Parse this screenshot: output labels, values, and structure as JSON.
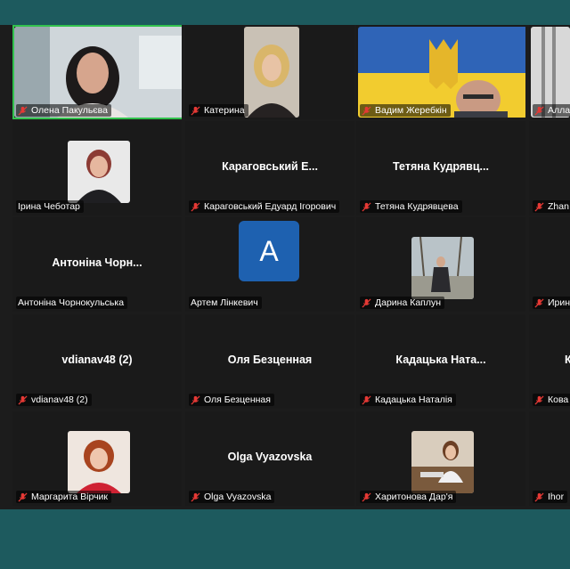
{
  "participants": [
    {
      "name": "Олена Пакульєва",
      "center": "",
      "kind": "video-woman"
    },
    {
      "name": "Катерина",
      "center": "",
      "kind": "video-blonde"
    },
    {
      "name": "Вадим Жеребкін",
      "center": "",
      "kind": "video-flag"
    },
    {
      "name": "Алла",
      "center": "",
      "kind": "video-edge"
    },
    {
      "name": "Ірина Чеботар",
      "center": "",
      "kind": "photo-woman"
    },
    {
      "name": "Караговський Едуард Ігорович",
      "center": "Караговський  Е...",
      "kind": "name"
    },
    {
      "name": "Тетяна Кудрявцева",
      "center": "Тетяна  Кудрявц...",
      "kind": "name"
    },
    {
      "name": "Zhan",
      "center": "",
      "kind": "name"
    },
    {
      "name": "Антоніна Чорнокульська",
      "center": "Антоніна  Чорн...",
      "kind": "name"
    },
    {
      "name": "Артем Лінкевич",
      "center": "",
      "kind": "avatar",
      "initial": "A"
    },
    {
      "name": "Дарина Каплун",
      "center": "",
      "kind": "photo-street"
    },
    {
      "name": "Ирин",
      "center": "",
      "kind": "name"
    },
    {
      "name": "vdianav48 (2)",
      "center": "vdianav48 (2)",
      "kind": "name"
    },
    {
      "name": "Оля Безценная",
      "center": "Оля Безценная",
      "kind": "name"
    },
    {
      "name": "Кадацька Наталія",
      "center": "Кадацька  Ната...",
      "kind": "name"
    },
    {
      "name": "Кова",
      "center": "К",
      "kind": "name"
    },
    {
      "name": "Маргарита Вірчик",
      "center": "",
      "kind": "photo-redhair"
    },
    {
      "name": "Olga Vyazovska",
      "center": "Olga Vyazovska",
      "kind": "name"
    },
    {
      "name": "Харитонова Дар'я",
      "center": "",
      "kind": "photo-office"
    },
    {
      "name": "Ihor",
      "center": "",
      "kind": "name"
    }
  ],
  "colors": {
    "active_speaker": "#32c24d",
    "muted_icon": "#e53935",
    "avatar_bg": "#1e61b0",
    "window_bg": "#1d5a5e"
  }
}
